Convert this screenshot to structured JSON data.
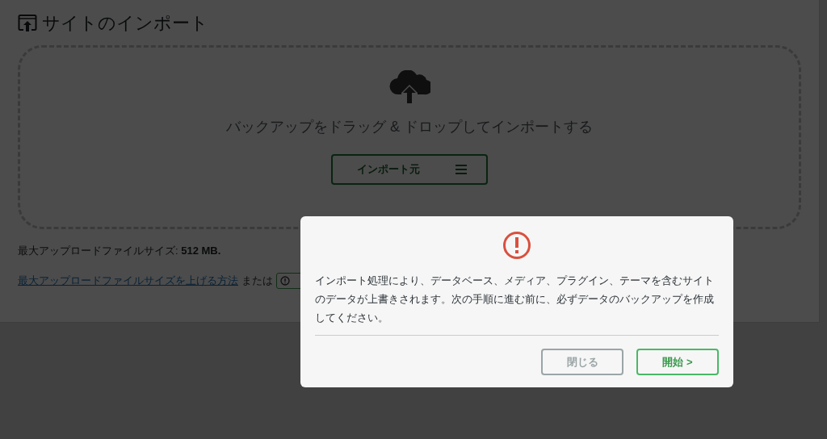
{
  "page": {
    "title": "サイトのインポート",
    "dropzone": {
      "text": "バックアップをドラッグ & ドロップしてインポートする",
      "button": "インポート元"
    },
    "max_size": "最大アップロードファイルサイズ: **512 MB.**",
    "help": {
      "link": "最大アップロードファイルサイズを上げる方法",
      "conjunction": "または"
    }
  },
  "modal": {
    "message": "インポート処理により、データベース、メディア、プラグイン、テーマを含むサイトのデータが上書きされます。次の手順に進む前に、必ずデータのバックアップを作成してください。",
    "buttons": [
      {
        "label": "閉じる",
        "kind": "secondary"
      },
      {
        "label": "開始 >",
        "kind": "primary"
      }
    ]
  }
}
